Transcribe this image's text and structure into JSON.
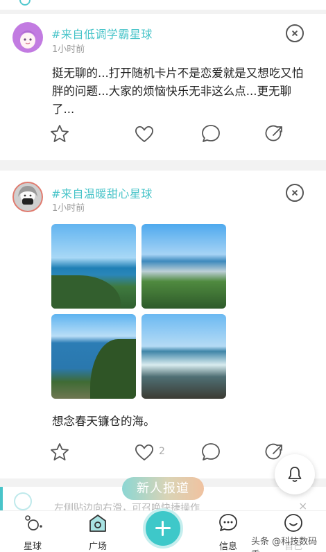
{
  "feed": {
    "posts": [
      {
        "planet": "#来自低调学霸星球",
        "time": "1小时前",
        "text": "挺无聊的...打开随机卡片不是恋爱就是又想吃又怕胖的问题...大家的烦恼快乐无非这么点...更无聊了...",
        "like_count": ""
      },
      {
        "planet": "#来自温暖甜心星球",
        "time": "1小时前",
        "text": "想念春天镰仓的海。",
        "like_count": "2",
        "photo_count": 4
      }
    ]
  },
  "banner": {
    "text": "左侧贴边向右滑，可召唤快捷操作",
    "close": "×"
  },
  "newbie_button": "新人报道",
  "nav": {
    "items": [
      {
        "label": "星球",
        "icon": "planet-icon"
      },
      {
        "label": "广场",
        "icon": "plaza-icon"
      },
      {
        "label": "",
        "icon": "plus-icon"
      },
      {
        "label": "信息",
        "icon": "message-icon"
      },
      {
        "label": "自己",
        "icon": "smile-icon"
      }
    ]
  },
  "watermark": "头条 @科技数码秀",
  "colors": {
    "accent": "#48c4c9",
    "add_button": "#3ec8c9",
    "muted_text": "#999999",
    "text": "#222222"
  },
  "icons": [
    "star-icon",
    "heart-icon",
    "comment-icon",
    "share-icon",
    "close-icon",
    "bell-icon"
  ]
}
